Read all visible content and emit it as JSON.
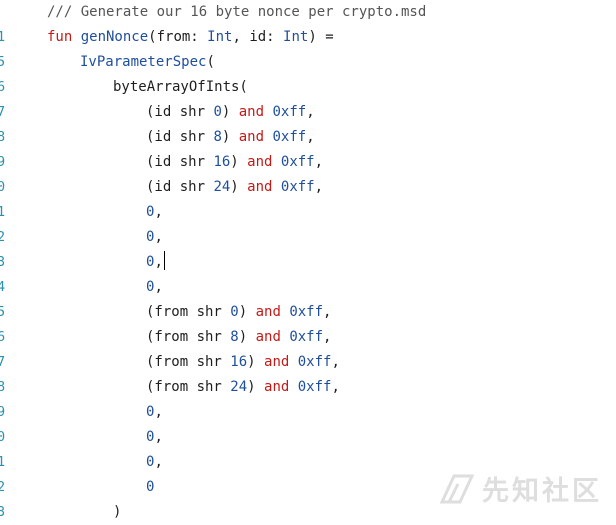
{
  "editor": {
    "gutter_fragments": [
      "",
      "1",
      "5",
      "6",
      "7",
      "8",
      "9",
      "0",
      "1",
      "2",
      "3",
      "4",
      "5",
      "6",
      "7",
      "8",
      "9",
      "0",
      "1",
      "2",
      "3"
    ],
    "lines": [
      {
        "tokens": [
          {
            "t": "/// Generate our 16 byte nonce per crypto.msd",
            "k": "comment"
          }
        ]
      },
      {
        "tokens": [
          {
            "t": "fun ",
            "k": "kw"
          },
          {
            "t": "genNonce",
            "k": "fn"
          },
          {
            "t": "(from: ",
            "k": "plain"
          },
          {
            "t": "Int",
            "k": "type"
          },
          {
            "t": ", id: ",
            "k": "plain"
          },
          {
            "t": "Int",
            "k": "type"
          },
          {
            "t": ") =",
            "k": "plain"
          }
        ]
      },
      {
        "tokens": [
          {
            "t": "IvParameterSpec",
            "k": "fn"
          },
          {
            "t": "(",
            "k": "plain"
          }
        ]
      },
      {
        "tokens": [
          {
            "t": "byteArrayOfInts(",
            "k": "plain"
          }
        ]
      },
      {
        "tokens": [
          {
            "t": "(id shr ",
            "k": "plain"
          },
          {
            "t": "0",
            "k": "num"
          },
          {
            "t": ") ",
            "k": "plain"
          },
          {
            "t": "and",
            "k": "kw"
          },
          {
            "t": " ",
            "k": "plain"
          },
          {
            "t": "0xff",
            "k": "num"
          },
          {
            "t": ",",
            "k": "plain"
          }
        ]
      },
      {
        "tokens": [
          {
            "t": "(id shr ",
            "k": "plain"
          },
          {
            "t": "8",
            "k": "num"
          },
          {
            "t": ") ",
            "k": "plain"
          },
          {
            "t": "and",
            "k": "kw"
          },
          {
            "t": " ",
            "k": "plain"
          },
          {
            "t": "0xff",
            "k": "num"
          },
          {
            "t": ",",
            "k": "plain"
          }
        ]
      },
      {
        "tokens": [
          {
            "t": "(id shr ",
            "k": "plain"
          },
          {
            "t": "16",
            "k": "num"
          },
          {
            "t": ") ",
            "k": "plain"
          },
          {
            "t": "and",
            "k": "kw"
          },
          {
            "t": " ",
            "k": "plain"
          },
          {
            "t": "0xff",
            "k": "num"
          },
          {
            "t": ",",
            "k": "plain"
          }
        ]
      },
      {
        "tokens": [
          {
            "t": "(id shr ",
            "k": "plain"
          },
          {
            "t": "24",
            "k": "num"
          },
          {
            "t": ") ",
            "k": "plain"
          },
          {
            "t": "and",
            "k": "kw"
          },
          {
            "t": " ",
            "k": "plain"
          },
          {
            "t": "0xff",
            "k": "num"
          },
          {
            "t": ",",
            "k": "plain"
          }
        ]
      },
      {
        "tokens": [
          {
            "t": "0",
            "k": "num"
          },
          {
            "t": ",",
            "k": "plain"
          }
        ]
      },
      {
        "tokens": [
          {
            "t": "0",
            "k": "num"
          },
          {
            "t": ",",
            "k": "plain"
          }
        ]
      },
      {
        "tokens": [
          {
            "t": "0",
            "k": "num"
          },
          {
            "t": ",",
            "k": "plain"
          }
        ],
        "caret": true
      },
      {
        "tokens": [
          {
            "t": "0",
            "k": "num"
          },
          {
            "t": ",",
            "k": "plain"
          }
        ]
      },
      {
        "tokens": [
          {
            "t": "(from shr ",
            "k": "plain"
          },
          {
            "t": "0",
            "k": "num"
          },
          {
            "t": ") ",
            "k": "plain"
          },
          {
            "t": "and",
            "k": "kw"
          },
          {
            "t": " ",
            "k": "plain"
          },
          {
            "t": "0xff",
            "k": "num"
          },
          {
            "t": ",",
            "k": "plain"
          }
        ]
      },
      {
        "tokens": [
          {
            "t": "(from shr ",
            "k": "plain"
          },
          {
            "t": "8",
            "k": "num"
          },
          {
            "t": ") ",
            "k": "plain"
          },
          {
            "t": "and",
            "k": "kw"
          },
          {
            "t": " ",
            "k": "plain"
          },
          {
            "t": "0xff",
            "k": "num"
          },
          {
            "t": ",",
            "k": "plain"
          }
        ]
      },
      {
        "tokens": [
          {
            "t": "(from shr ",
            "k": "plain"
          },
          {
            "t": "16",
            "k": "num"
          },
          {
            "t": ") ",
            "k": "plain"
          },
          {
            "t": "and",
            "k": "kw"
          },
          {
            "t": " ",
            "k": "plain"
          },
          {
            "t": "0xff",
            "k": "num"
          },
          {
            "t": ",",
            "k": "plain"
          }
        ]
      },
      {
        "tokens": [
          {
            "t": "(from shr ",
            "k": "plain"
          },
          {
            "t": "24",
            "k": "num"
          },
          {
            "t": ") ",
            "k": "plain"
          },
          {
            "t": "and",
            "k": "kw"
          },
          {
            "t": " ",
            "k": "plain"
          },
          {
            "t": "0xff",
            "k": "num"
          },
          {
            "t": ",",
            "k": "plain"
          }
        ]
      },
      {
        "tokens": [
          {
            "t": "0",
            "k": "num"
          },
          {
            "t": ",",
            "k": "plain"
          }
        ]
      },
      {
        "tokens": [
          {
            "t": "0",
            "k": "num"
          },
          {
            "t": ",",
            "k": "plain"
          }
        ]
      },
      {
        "tokens": [
          {
            "t": "0",
            "k": "num"
          },
          {
            "t": ",",
            "k": "plain"
          }
        ]
      },
      {
        "tokens": [
          {
            "t": "0",
            "k": "num"
          }
        ]
      },
      {
        "tokens": [
          {
            "t": ")",
            "k": "plain"
          }
        ]
      }
    ],
    "colors": {
      "comment": "#555555",
      "keyword": "#c41a16",
      "identifier": "#1f4e9c",
      "plain": "#1e1e1e",
      "line_number": "#2b91af",
      "background": "#ffffff"
    }
  },
  "watermark": {
    "text": "先知社区",
    "icon": "xianzhi-logo-icon"
  }
}
